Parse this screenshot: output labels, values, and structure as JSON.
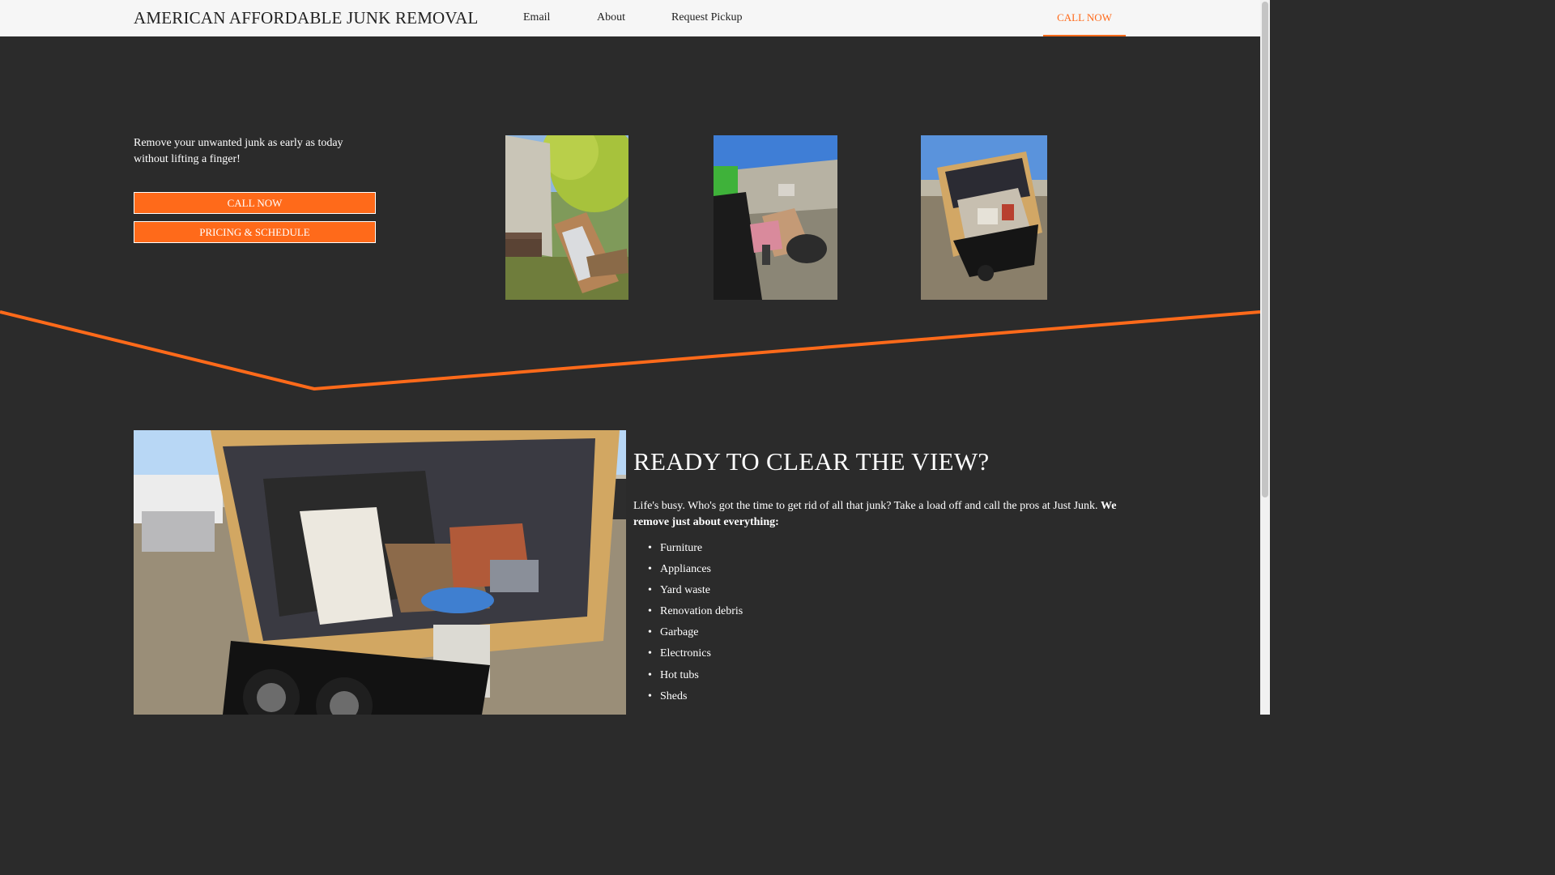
{
  "header": {
    "brand": "AMERICAN AFFORDABLE JUNK REMOVAL",
    "nav": {
      "email": "Email",
      "about": "About",
      "request_pickup": "Request Pickup"
    },
    "call_now": "CALL NOW"
  },
  "hero": {
    "tagline": "Remove your unwanted junk as early as today without lifting a finger!",
    "call_button": "CALL NOW",
    "pricing_button": "PRICING & SCHEDULE"
  },
  "section": {
    "heading": "READY TO CLEAR THE VIEW?",
    "body_text": "Life's busy. Who's got the time to get rid of all that junk? Take a load off and call the pros at Just Junk. ",
    "body_emphasis": "We remove just about everything:",
    "items": [
      "Furniture",
      "Appliances",
      "Yard waste",
      "Renovation debris",
      "Garbage",
      "Electronics",
      "Hot tubs",
      "Sheds"
    ]
  },
  "colors": {
    "accent": "#ff6a1a",
    "background": "#2b2b2b",
    "header_bg": "#f6f6f6"
  }
}
